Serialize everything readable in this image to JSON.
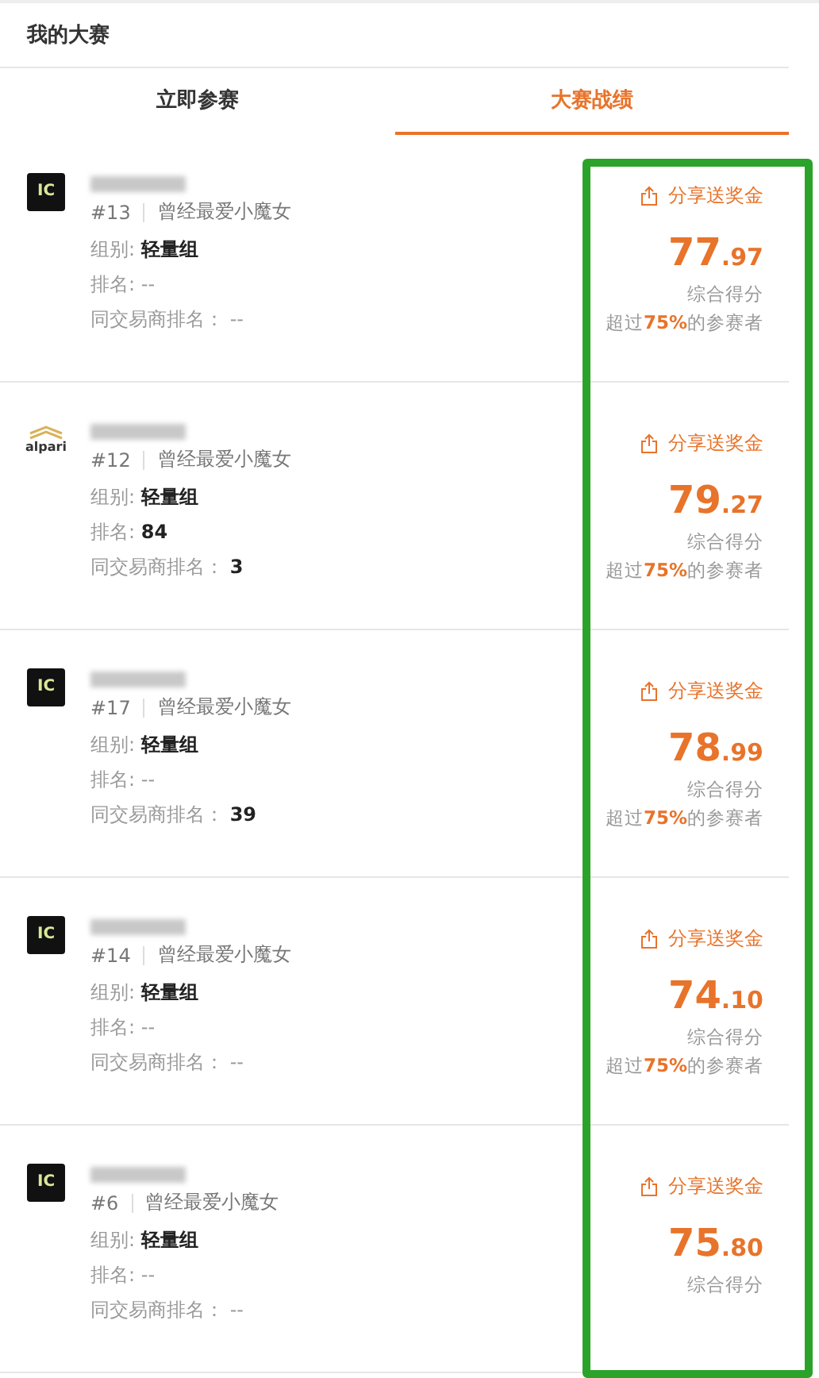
{
  "header": {
    "title": "我的大赛"
  },
  "tabs": [
    {
      "label": "立即参赛",
      "selected": false
    },
    {
      "label": "大赛战绩",
      "selected": true
    }
  ],
  "entries": [
    {
      "logo": {
        "kind": "ic",
        "text": "IC"
      },
      "rank": "#13",
      "nickname": "曾经最爱小魔女",
      "group": "组别: **轻量组**",
      "position": "排名: --",
      "broker_rank": "同交易商排名： --",
      "share": "分享送奖金",
      "score_int": "77",
      "score_dec": ".97",
      "score_label": "综合得分",
      "percentile": "超过**75%**的参赛者"
    },
    {
      "logo": {
        "kind": "alpari",
        "text": "alpari"
      },
      "rank": "#12",
      "nickname": "曾经最爱小魔女",
      "group": "组别: **轻量组**",
      "position": "排名: **84**",
      "broker_rank": "同交易商排名： **3**",
      "share": "分享送奖金",
      "score_int": "79",
      "score_dec": ".27",
      "score_label": "综合得分",
      "percentile": "超过**75%**的参赛者"
    },
    {
      "logo": {
        "kind": "ic",
        "text": "IC"
      },
      "rank": "#17",
      "nickname": "曾经最爱小魔女",
      "group": "组别: **轻量组**",
      "position": "排名: --",
      "broker_rank": "同交易商排名： **39**",
      "share": "分享送奖金",
      "score_int": "78",
      "score_dec": ".99",
      "score_label": "综合得分",
      "percentile": "超过**75%**的参赛者"
    },
    {
      "logo": {
        "kind": "ic",
        "text": "IC"
      },
      "rank": "#14",
      "nickname": "曾经最爱小魔女",
      "group": "组别: **轻量组**",
      "position": "排名: --",
      "broker_rank": "同交易商排名： --",
      "share": "分享送奖金",
      "score_int": "74",
      "score_dec": ".10",
      "score_label": "综合得分",
      "percentile": "超过**75%**的参赛者"
    },
    {
      "logo": {
        "kind": "ic",
        "text": "IC"
      },
      "rank": "#6",
      "nickname": "曾经最爱小魔女",
      "group": "组别: **轻量组**",
      "position": "排名: --",
      "broker_rank": "同交易商排名： --",
      "share": "分享送奖金",
      "score_int": "75",
      "score_dec": ".80",
      "score_label": "综合得分"
    }
  ]
}
